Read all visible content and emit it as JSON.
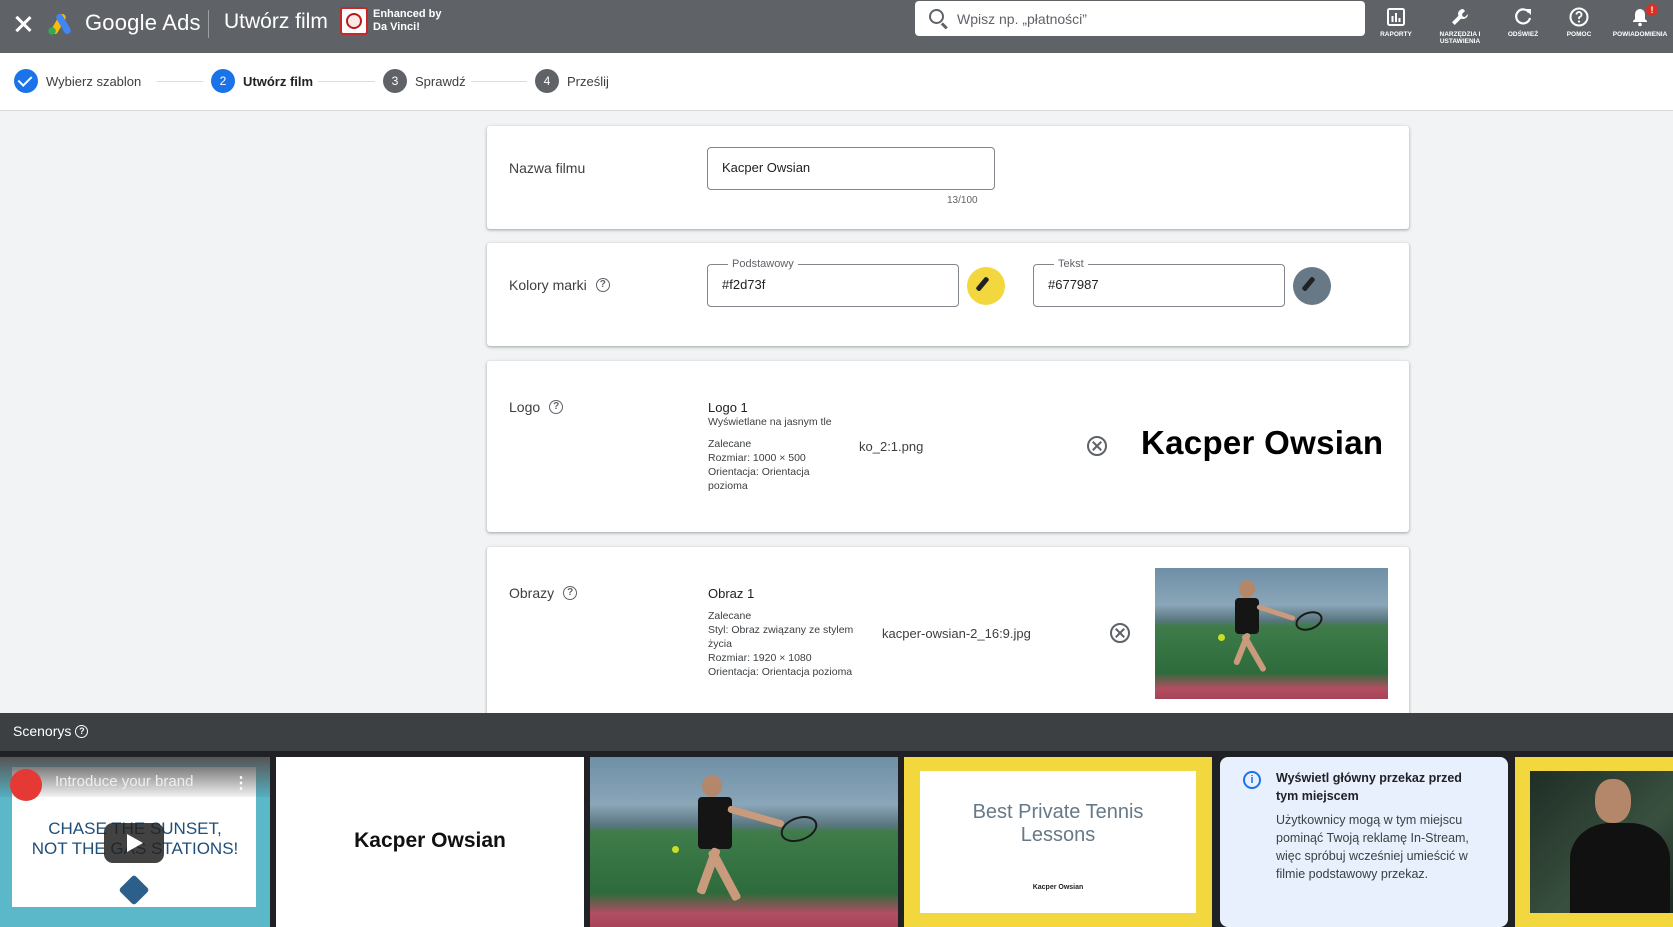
{
  "topbar": {
    "brand": "Google Ads",
    "page_title": "Utwórz film",
    "extension_label_1": "Enhanced by",
    "extension_label_2": "Da Vinci!",
    "search_placeholder": "Wpisz np. „płatności”",
    "actions": [
      {
        "label": "RAPORTY",
        "icon": "reports-icon"
      },
      {
        "label": "NARZĘDZIA I USTAWIENIA",
        "icon": "wrench-icon"
      },
      {
        "label": "ODŚWIEŻ",
        "icon": "refresh-icon"
      },
      {
        "label": "POMOC",
        "icon": "help-icon"
      },
      {
        "label": "POWIADOMIENIA",
        "icon": "bell-icon",
        "badge": "!"
      }
    ]
  },
  "stepper": {
    "steps": [
      {
        "number": "",
        "label": "Wybierz szablon",
        "state": "done"
      },
      {
        "number": "2",
        "label": "Utwórz film",
        "state": "active"
      },
      {
        "number": "3",
        "label": "Sprawdź",
        "state": "todo"
      },
      {
        "number": "4",
        "label": "Prześlij",
        "state": "todo"
      }
    ]
  },
  "video_name": {
    "label": "Nazwa filmu",
    "value": "Kacper Owsian",
    "counter": "13/100"
  },
  "brand_colors": {
    "label": "Kolory marki",
    "primary_label": "Podstawowy",
    "primary_value": "#f2d73f",
    "text_label": "Tekst",
    "text_value": "#677987",
    "primary_color": "#f2d73f",
    "text_color": "#677987"
  },
  "logo": {
    "label": "Logo",
    "title": "Logo 1",
    "subtitle": "Wyświetlane na jasnym tle",
    "rec_1": "Zalecane",
    "rec_2": "Rozmiar: 1000 × 500",
    "rec_3": "Orientacja: Orientacja",
    "rec_4": "pozioma",
    "file": "ko_2:1.png",
    "preview_text": "Kacper Owsian"
  },
  "images": {
    "label": "Obrazy",
    "title": "Obraz 1",
    "rec_1": "Zalecane",
    "rec_2": "Styl: Obraz związany ze stylem",
    "rec_3": "życia",
    "rec_4": "Rozmiar: 1920 × 1080",
    "rec_5": "Orientacja: Orientacja pozioma",
    "file": "kacper-owsian-2_16:9.jpg"
  },
  "scenes": {
    "title": "Scenorys",
    "scene1": {
      "overlay": "Introduce your brand",
      "line1": "CHASE THE SUNSET,",
      "line2": "NOT THE GAS STATIONS!"
    },
    "scene2": {
      "text": "Kacper Owsian"
    },
    "scene4": {
      "title": "Best Private Tennis Lessons",
      "small": "Kacper Owsian"
    },
    "info": {
      "heading": "Wyświetl główny przekaz przed tym miejscem",
      "body": "Użytkownicy mogą w tym miejscu pominąć Twoją reklamę In-Stream, więc spróbuj wcześniej umieścić w filmie podstawowy przekaz."
    }
  }
}
